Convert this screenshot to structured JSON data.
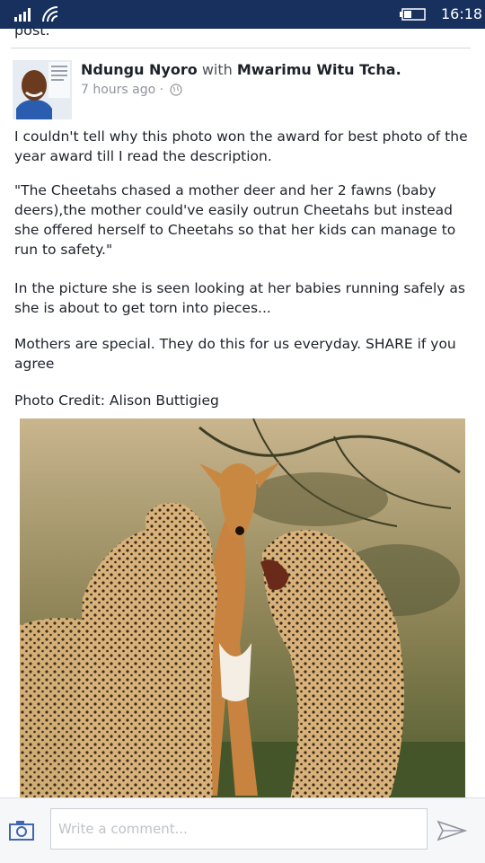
{
  "status_bar": {
    "time": "16:18",
    "icons": [
      "signal-icon",
      "wifi-icon",
      "battery-icon"
    ]
  },
  "feed": {
    "previous_post_tail": "post.",
    "post": {
      "author": "Ndungu Nyoro",
      "with_text": "with",
      "tagged": "Mwarimu Witu Tcha.",
      "timestamp": "7 hours ago",
      "separator": "·",
      "privacy_icon": "globe-icon",
      "paragraphs": [
        "I couldn't tell why this photo won the award for best photo of the year award till I read the description.",
        "\"The Cheetahs chased a mother deer and her 2 fawns (baby deers),the mother could've easily outrun Cheetahs but instead she offered herself to Cheetahs so that her kids can manage to run to safety.\"",
        "In the picture she is seen looking at her babies running safely as she is about to get torn into pieces...",
        "Mothers are special. They do this for us everyday. SHARE if you agree",
        "Photo Credit: Alison Buttigieg"
      ]
    }
  },
  "comment_bar": {
    "placeholder": "Write a comment...",
    "camera_icon": "camera-icon",
    "send_icon": "send-icon"
  },
  "colors": {
    "status_bar_bg": "#17305e",
    "text": "#1d2129",
    "muted": "#90949c",
    "accent": "#4267b2"
  }
}
